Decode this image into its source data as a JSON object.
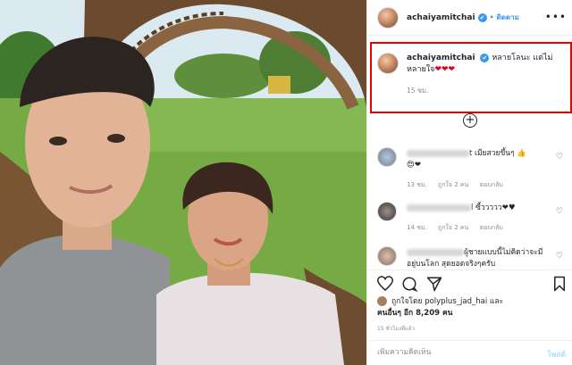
{
  "post": {
    "username": "achaiyamitchai",
    "verified_mark": "✔",
    "follow_label": "• ติดตาม",
    "more_icon": "more-horizontal-icon",
    "caption": {
      "text": "หลายโลนะ แต่ไม่หลายใจ",
      "hearts": "❤❤❤",
      "time": "15 ชม."
    },
    "load_more_icon": "plus-circle-icon",
    "comments": [
      {
        "text_visible": "t เมียสวยขึ้นๆ 👍",
        "text_line2": "😍❤",
        "time": "13 ชม.",
        "likes": "ถูกใจ 2 คน",
        "reply": "ตอบกลับ"
      },
      {
        "text_visible": "l ซี้ววววว❤♥",
        "time": "14 ชม.",
        "likes": "ถูกใจ 2 คน",
        "reply": "ตอบกลับ"
      },
      {
        "text_visible": "ผู้ชายแบบนี้ไม่คิดว่าจะมี",
        "text_line2": "อยู่บนโลก สุดยอดจริงๆครับ"
      }
    ],
    "likes_line1": "ถูกใจโดย polyplus_jad_hai และ",
    "likes_line2": "คนอื่นๆ อีก 8,209 คน",
    "posted_ago": "15 ชั่วโมงที่แล้ว",
    "comment_placeholder": "เพิ่มความคิดเห็น",
    "post_button": "โพสต์"
  },
  "colors": {
    "accent": "#3897f0",
    "highlight_border": "#e60000",
    "heart": "#e0001b",
    "muted": "#8e8e8e"
  }
}
